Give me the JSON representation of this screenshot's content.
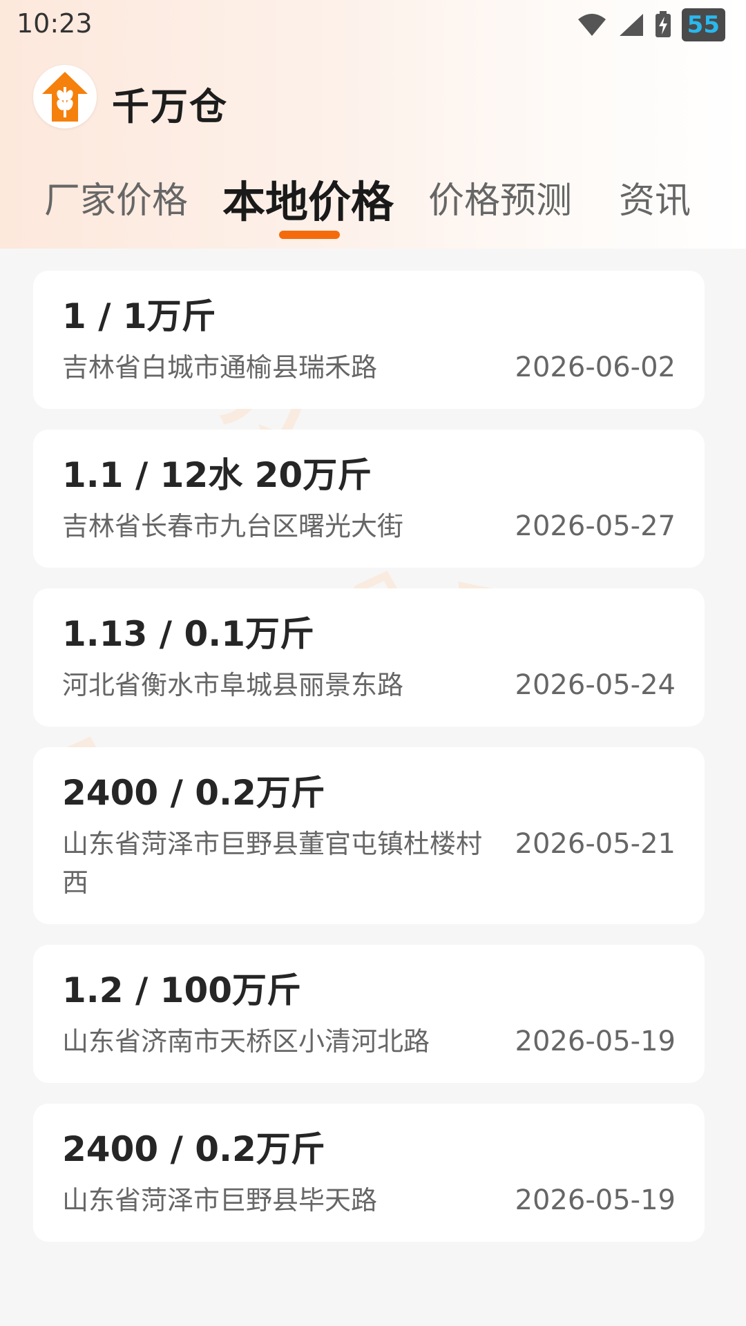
{
  "status_bar": {
    "time": "10:23",
    "battery": "55"
  },
  "app": {
    "name": "千万仓",
    "logo_icon": "wheat-house-logo-icon"
  },
  "tabs": [
    {
      "label": "厂家价格",
      "active": false
    },
    {
      "label": "本地价格",
      "active": true
    },
    {
      "label": "价格预测",
      "active": false
    },
    {
      "label": "资讯",
      "active": false
    }
  ],
  "items": [
    {
      "price": "1 / 1万斤",
      "address": "吉林省白城市通榆县瑞禾路",
      "date": "2026-06-02"
    },
    {
      "price": "1.1 / 12水 20万斤",
      "address": "吉林省长春市九台区曙光大街",
      "date": "2026-05-27"
    },
    {
      "price": "1.13 / 0.1万斤",
      "address": "河北省衡水市阜城县丽景东路",
      "date": "2026-05-24"
    },
    {
      "price": "2400 / 0.2万斤",
      "address": "山东省菏泽市巨野县董官屯镇杜楼村西",
      "date": "2026-05-21"
    },
    {
      "price": "1.2 / 100万斤",
      "address": "山东省济南市天桥区小清河北路",
      "date": "2026-05-19"
    },
    {
      "price": "2400 / 0.2万斤",
      "address": "山东省菏泽市巨野县毕天路",
      "date": "2026-05-19"
    }
  ],
  "colors": {
    "accent": "#f56b0c",
    "battery_text": "#29b8ee"
  }
}
